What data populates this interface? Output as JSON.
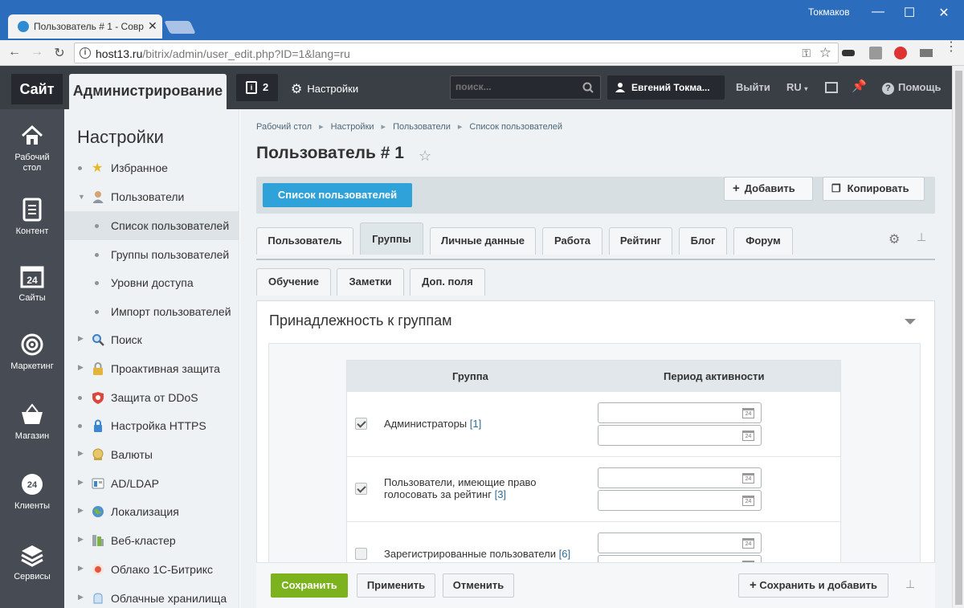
{
  "browser": {
    "tab_title": "Пользователь # 1 - Совр",
    "window_user": "Токмаков",
    "url_host": "host13.ru",
    "url_path": "/bitrix/admin/user_edit.php?ID=1&lang=ru"
  },
  "topbar": {
    "site_label": "Сайт",
    "admin_label": "Администрирование",
    "notifications_count": "2",
    "settings_label": "Настройки",
    "search_placeholder": "поиск...",
    "user_name": "Евгений Токма...",
    "logout_label": "Выйти",
    "lang_label": "RU",
    "help_label": "Помощь"
  },
  "leftnav": [
    {
      "label": "Рабочий стол",
      "icon": "home-icon"
    },
    {
      "label": "Контент",
      "icon": "document-icon"
    },
    {
      "label": "Сайты",
      "icon": "calendar-24-icon"
    },
    {
      "label": "Маркетинг",
      "icon": "target-icon"
    },
    {
      "label": "Магазин",
      "icon": "basket-icon"
    },
    {
      "label": "Клиенты",
      "icon": "clients-24-icon"
    },
    {
      "label": "Сервисы",
      "icon": "layers-icon"
    }
  ],
  "menu": {
    "title": "Настройки",
    "items": [
      {
        "label": "Избранное",
        "icon": "star-icon"
      },
      {
        "label": "Пользователи",
        "icon": "user-icon"
      },
      {
        "label": "Список пользователей"
      },
      {
        "label": "Группы пользователей"
      },
      {
        "label": "Уровни доступа"
      },
      {
        "label": "Импорт пользователей"
      },
      {
        "label": "Поиск",
        "icon": "search-icon"
      },
      {
        "label": "Проактивная защита",
        "icon": "lock-icon"
      },
      {
        "label": "Защита от DDoS",
        "icon": "shield-icon"
      },
      {
        "label": "Настройка HTTPS",
        "icon": "https-lock-icon"
      },
      {
        "label": "Валюты",
        "icon": "currency-icon"
      },
      {
        "label": "AD/LDAP",
        "icon": "ldap-icon"
      },
      {
        "label": "Локализация",
        "icon": "globe-icon"
      },
      {
        "label": "Веб-кластер",
        "icon": "cluster-icon"
      },
      {
        "label": "Облако 1С-Битрикс",
        "icon": "cloud-icon"
      },
      {
        "label": "Облачные хранилища",
        "icon": "storage-icon"
      }
    ]
  },
  "content": {
    "breadcrumb": [
      "Рабочий стол",
      "Настройки",
      "Пользователи",
      "Список пользователей"
    ],
    "page_title": "Пользователь # 1",
    "list_button": "Список пользователей",
    "add_button": "Добавить",
    "copy_button": "Копировать",
    "tabs_row1": [
      "Пользователь",
      "Группы",
      "Личные данные",
      "Работа",
      "Рейтинг",
      "Блог",
      "Форум"
    ],
    "tabs_row2": [
      "Обучение",
      "Заметки",
      "Доп. поля"
    ],
    "section_title": "Принадлежность к группам",
    "table": {
      "col_group": "Группа",
      "col_period": "Период активности",
      "rows": [
        {
          "label": "Администраторы",
          "id": "[1]",
          "checked": true
        },
        {
          "label_line1": "Пользователи, имеющие право",
          "label_line2": "голосовать за рейтинг",
          "id": "[3]",
          "checked": true
        },
        {
          "label": "Зарегистрированные пользователи",
          "id": "[6]",
          "checked": false
        }
      ]
    },
    "bottom": {
      "save": "Сохранить",
      "apply": "Применить",
      "cancel": "Отменить",
      "save_add": "Сохранить и добавить"
    }
  },
  "colors": {
    "accent_blue": "#2fa2d9",
    "save_green": "#7cb21e",
    "browser_blue": "#2b6cbd"
  }
}
